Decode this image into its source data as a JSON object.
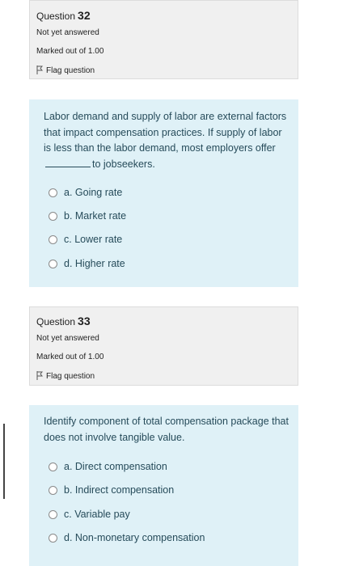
{
  "q32": {
    "label": "Question",
    "number": "32",
    "status": "Not yet answered",
    "marked": "Marked out of 1.00",
    "flag": "Flag question",
    "text_before_blank": "Labor demand and supply of labor are external factors that impact compensation practices. If supply of labor is less than the labor demand, most employers offer",
    "text_after_blank": "to jobseekers.",
    "options": [
      "a. Going rate",
      "b. Market rate",
      "c. Lower rate",
      "d. Higher rate"
    ]
  },
  "q33": {
    "label": "Question",
    "number": "33",
    "status": "Not yet answered",
    "marked": "Marked out of 1.00",
    "flag": "Flag question",
    "text": "Identify component of total compensation package that does not involve tangible value.",
    "options": [
      "a. Direct compensation",
      "b. Indirect compensation",
      "c. Variable pay",
      "d. Non-monetary compensation"
    ]
  }
}
